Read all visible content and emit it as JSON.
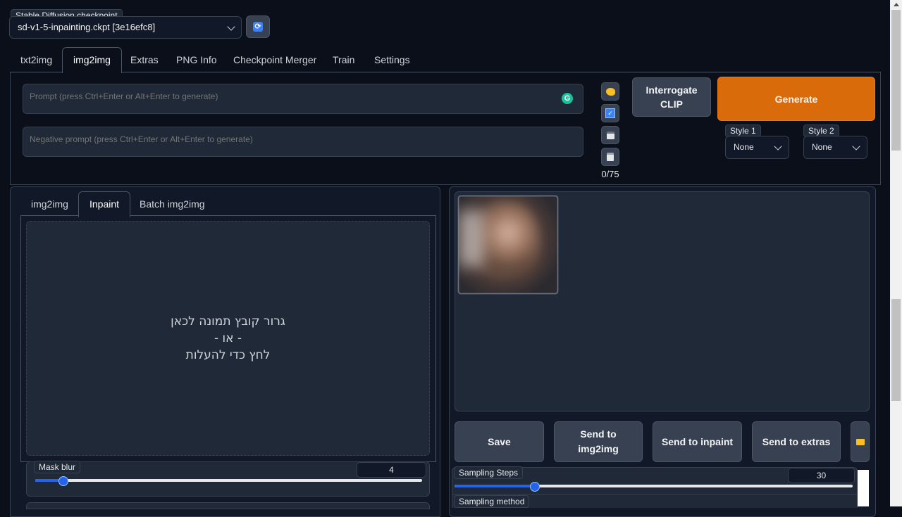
{
  "checkpoint": {
    "label": "Stable Diffusion checkpoint",
    "value": "sd-v1-5-inpainting.ckpt [3e16efc8]"
  },
  "main_tabs": [
    "txt2img",
    "img2img",
    "Extras",
    "PNG Info",
    "Checkpoint Merger",
    "Train",
    "Settings"
  ],
  "prompt": {
    "placeholder": "Prompt (press Ctrl+Enter or Alt+Enter to generate)",
    "value": ""
  },
  "negative_prompt": {
    "placeholder": "Negative prompt (press Ctrl+Enter or Alt+Enter to generate)",
    "value": ""
  },
  "token_counter": "0/75",
  "interrogate_label": "Interrogate CLIP",
  "generate_label": "Generate",
  "styles": [
    {
      "label": "Style 1",
      "value": "None"
    },
    {
      "label": "Style 2",
      "value": "None"
    }
  ],
  "sub_tabs": [
    "img2img",
    "Inpaint",
    "Batch img2img"
  ],
  "dropzone": {
    "line1": "גרור קובץ תמונה לכאן",
    "line2": "- או -",
    "line3": "לחץ כדי להעלות"
  },
  "mask_blur": {
    "label": "Mask blur",
    "value": "4",
    "fraction": 0.08
  },
  "output_actions": [
    "Save",
    "Send to img2img",
    "Send to inpaint",
    "Send to extras"
  ],
  "sampling_steps": {
    "label": "Sampling Steps",
    "value": "30",
    "fraction": 0.2
  },
  "sampling_method": {
    "label": "Sampling method"
  },
  "colors": {
    "accent": "#2563eb",
    "generate": "#d96b0b",
    "background": "#0b0f19"
  },
  "icons": [
    "refresh-icon",
    "chevron-down-icon",
    "grammarly-icon",
    "palette-icon",
    "checkbox-icon",
    "floppy-disk-icon",
    "clipboard-icon",
    "folder-icon"
  ]
}
